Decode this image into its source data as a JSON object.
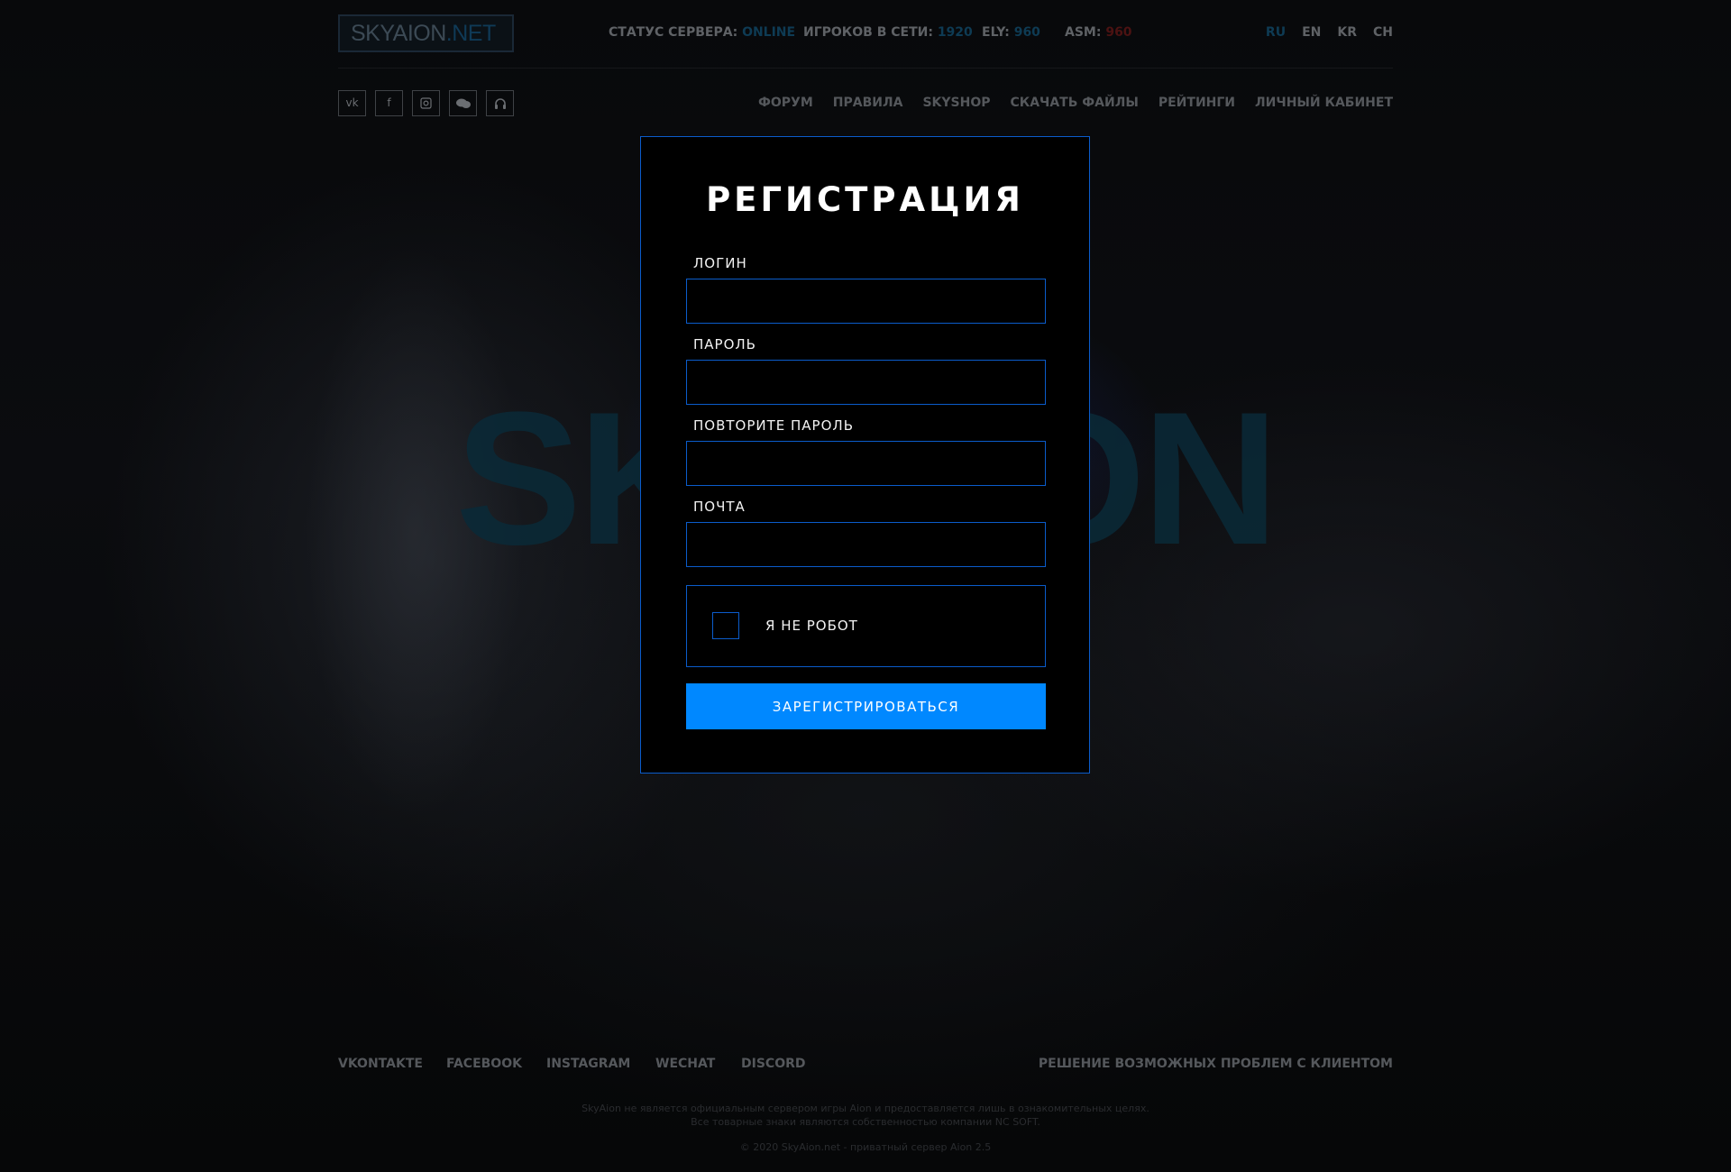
{
  "header": {
    "logo": {
      "main": "SKYAION",
      "suffix": ".NET"
    },
    "server_status": {
      "label": "СТАТУС СЕРВЕРА:",
      "value": "ONLINE"
    },
    "players_online": {
      "label": "ИГРОКОВ В СЕТИ:",
      "value": "1920"
    },
    "ely": {
      "label": "ELY:",
      "value": "960"
    },
    "asm": {
      "label": "ASM:",
      "value": "960"
    },
    "languages": [
      "RU",
      "EN",
      "KR",
      "CH"
    ],
    "active_language": "RU",
    "social_icons": [
      "vk-icon",
      "facebook-icon",
      "instagram-icon",
      "chat-icon",
      "headset-icon"
    ],
    "nav": [
      "ФОРУМ",
      "ПРАВИЛА",
      "SKYSHOP",
      "СКАЧАТЬ ФАЙЛЫ",
      "РЕЙТИНГИ",
      "ЛИЧНЫЙ КАБИНЕТ"
    ]
  },
  "background": {
    "watermark": "SKYAION"
  },
  "registration": {
    "title": "РЕГИСТРАЦИЯ",
    "fields": {
      "login": {
        "label": "ЛОГИН",
        "value": ""
      },
      "password": {
        "label": "ПАРОЛЬ",
        "value": ""
      },
      "password_repeat": {
        "label": "ПОВТОРИТЕ ПАРОЛЬ",
        "value": ""
      },
      "email": {
        "label": "ПОЧТА",
        "value": ""
      }
    },
    "captcha_label": "Я НЕ РОБОТ",
    "captcha_checked": false,
    "submit_label": "ЗАРЕГИСТРИРОВАТЬСЯ"
  },
  "footer": {
    "links": [
      "VKONTAKTE",
      "FACEBOOK",
      "INSTAGRAM",
      "WECHAT",
      "DISCORD"
    ],
    "help_link": "РЕШЕНИЕ ВОЗМОЖНЫХ ПРОБЛЕМ С КЛИЕНТОМ",
    "disclaimer_line1": "SkyAion не является официальным сервером игры Aion и предоставляется лишь в ознакомительных целях.",
    "disclaimer_line2": "Все товарные знаки являются собственностью компании NC SOFT.",
    "copyright": "© 2020 SkyAion.net - приватный сервер Aion 2.5"
  },
  "colors": {
    "accent": "#0088ff",
    "border": "#0b5ccb",
    "background": "#050607"
  }
}
